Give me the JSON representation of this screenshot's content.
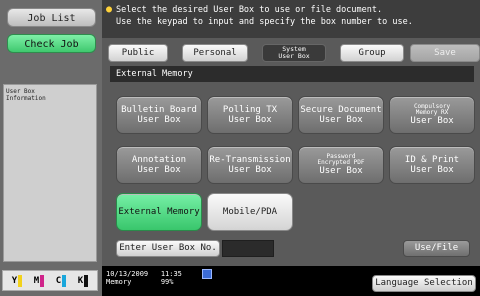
{
  "left_panel": {
    "job_list_label": "Job List",
    "check_job_label": "Check Job",
    "user_box_info_label": "User Box\nInformation",
    "toner": [
      {
        "letter": "Y",
        "color": "#f2d21b"
      },
      {
        "letter": "M",
        "color": "#d0248a"
      },
      {
        "letter": "C",
        "color": "#1aa7dc"
      },
      {
        "letter": "K",
        "color": "#111111"
      }
    ]
  },
  "message": {
    "line1": "Select the desired User Box to use or file document.",
    "line2": "Use the keypad to input and specify the box number to use."
  },
  "tabs": [
    {
      "label": "Public",
      "state": "normal"
    },
    {
      "label": "Personal",
      "state": "normal"
    },
    {
      "label": "System\nUser Box",
      "state": "active"
    },
    {
      "label": "Group",
      "state": "normal"
    },
    {
      "label": "Save Document",
      "state": "disabled"
    }
  ],
  "section_title": "External Memory",
  "boxes": [
    {
      "line1": "Bulletin Board",
      "line2": "User Box"
    },
    {
      "line1": "Polling TX",
      "line2": "User Box"
    },
    {
      "line1": "Secure Document",
      "line2": "User Box"
    },
    {
      "line1": "Compulsory\nMemory RX",
      "line2": "User Box",
      "small": true
    },
    {
      "line1": "Annotation",
      "line2": "User Box"
    },
    {
      "line1": "Re-Transmission",
      "line2": "User Box"
    },
    {
      "line1": "Password\nEncrypted PDF",
      "line2": "User Box",
      "small": true
    },
    {
      "line1": "ID & Print",
      "line2": "User Box"
    },
    {
      "line1": "External Memory",
      "line2": "",
      "selected": true
    },
    {
      "line1": "Mobile/PDA",
      "line2": "",
      "plain": true
    }
  ],
  "enter_user_box_label": "Enter User Box No.",
  "use_file_label": "Use/File",
  "status": {
    "date": "10/13/2009",
    "time": "11:35",
    "memory_label": "Memory",
    "memory_value": "99%"
  },
  "language_selection_label": "Language Selection"
}
